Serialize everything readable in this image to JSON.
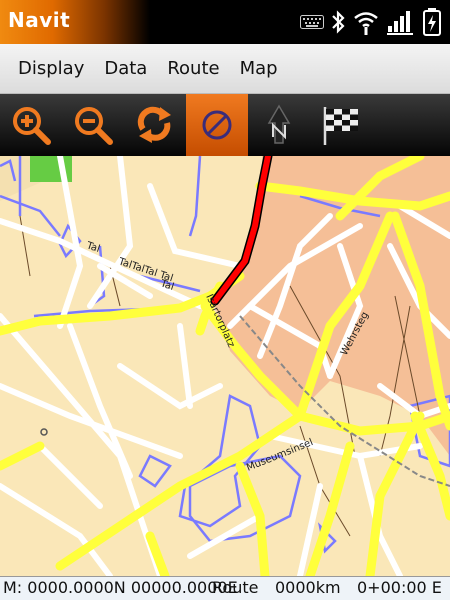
{
  "app": {
    "title": "Navit"
  },
  "status_icons": [
    "keyboard-icon",
    "bluetooth-icon",
    "wifi-icon",
    "signal-icon",
    "battery-icon"
  ],
  "menu": {
    "items": [
      {
        "label": "Display"
      },
      {
        "label": "Data"
      },
      {
        "label": "Route"
      },
      {
        "label": "Map"
      }
    ]
  },
  "toolbar": {
    "buttons": [
      {
        "name": "zoom-in-icon"
      },
      {
        "name": "zoom-out-icon"
      },
      {
        "name": "refresh-route-icon"
      },
      {
        "name": "orientation-lock-icon",
        "active": true
      },
      {
        "name": "north-arrow-icon"
      },
      {
        "name": "destination-flag-icon"
      }
    ]
  },
  "map": {
    "labels": {
      "tal_1": "Tal",
      "tal_2": "TalTalTal Tal",
      "tal_3": "Tal",
      "isartorplatz": "Isartorplatz",
      "wehrsteg": "Wehrsteg",
      "museumsinsel": "Museumsinsel"
    }
  },
  "bottom": {
    "position": "M: 0000.0000N 00000.0000E",
    "route_label": "Route",
    "distance": "0000km",
    "time": "0+00:00 E"
  },
  "colors": {
    "accent": "#f07a20",
    "map_background": "#fae7b8",
    "road": "#ffff3c",
    "minor_road": "#ffffff",
    "route": "#ff0000",
    "building_outline": "#7a7aff",
    "urban_area": "#f5bf97",
    "park": "#66cc44"
  }
}
